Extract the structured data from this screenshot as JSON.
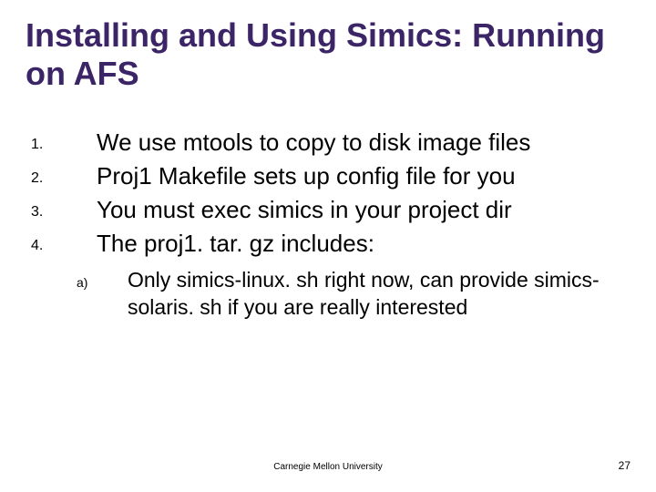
{
  "title": "Installing and Using Simics: Running on AFS",
  "items": [
    {
      "n": "1.",
      "t": "We use mtools to copy to disk image files"
    },
    {
      "n": "2.",
      "t": "Proj1 Makefile sets up config file for you"
    },
    {
      "n": "3.",
      "t": "You must exec simics in your project dir"
    },
    {
      "n": "4.",
      "t": "The proj1. tar. gz includes:"
    }
  ],
  "subitems": [
    {
      "n": "a)",
      "t": "Only simics-linux. sh right now, can provide simics-solaris. sh if you are really interested"
    }
  ],
  "footer_center": "Carnegie Mellon University",
  "footer_right": "27"
}
